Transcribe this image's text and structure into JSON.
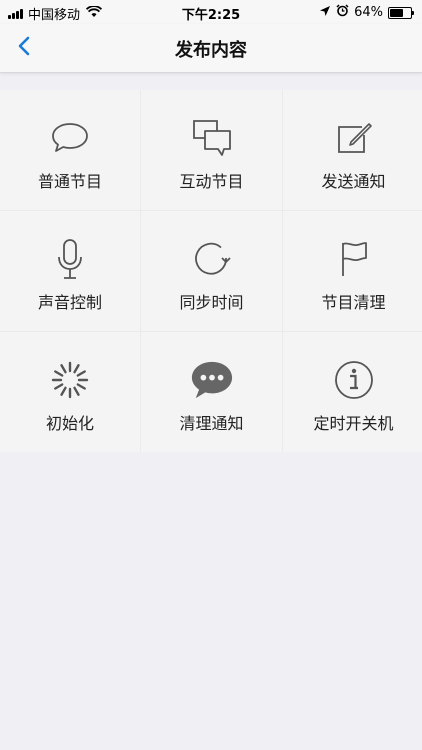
{
  "status_bar": {
    "carrier": "中国移动",
    "time": "下午2:25",
    "battery": "64%",
    "battery_level": 0.64
  },
  "nav": {
    "title": "发布内容",
    "back_icon": "chevron-left-icon"
  },
  "colors": {
    "accent": "#1a7ad8",
    "icon": "#555555",
    "tile_bg": "#f4f4f4",
    "page_bg": "#efeff4"
  },
  "tiles": [
    {
      "label": "普通节目",
      "icon": "speech-bubble-icon"
    },
    {
      "label": "互动节目",
      "icon": "two-bubbles-icon"
    },
    {
      "label": "发送通知",
      "icon": "edit-icon"
    },
    {
      "label": "声音控制",
      "icon": "microphone-icon"
    },
    {
      "label": "同步时间",
      "icon": "refresh-icon"
    },
    {
      "label": "节目清理",
      "icon": "flag-icon"
    },
    {
      "label": "初始化",
      "icon": "spinner-icon"
    },
    {
      "label": "清理通知",
      "icon": "chat-dots-icon"
    },
    {
      "label": "定时开关机",
      "icon": "info-icon"
    }
  ]
}
